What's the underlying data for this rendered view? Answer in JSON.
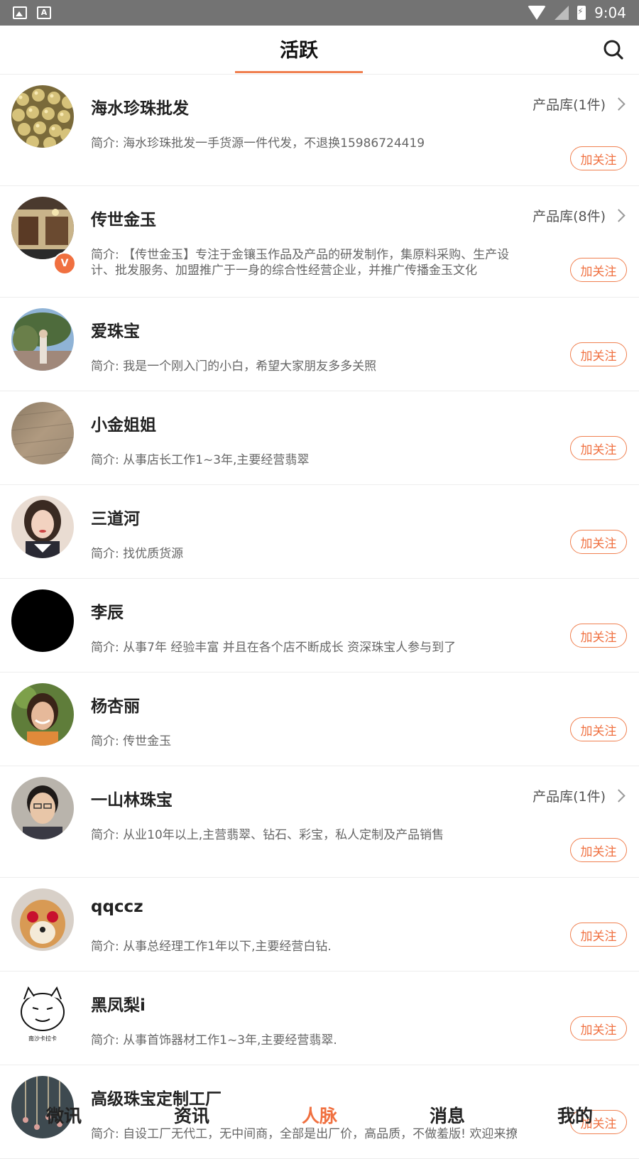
{
  "status_bar": {
    "time": "9:04",
    "font_icon_letter": "A"
  },
  "header": {
    "active_tab": "活跃"
  },
  "colors": {
    "accent": "#f07040",
    "status_bar": "#737373"
  },
  "list": [
    {
      "name": "海水珍珠批发",
      "bio": "简介: 海水珍珠批发一手货源一件代发，不退换15986724419",
      "products": "产品库(1件)",
      "follow": "加关注",
      "avatar": "pearl"
    },
    {
      "name": "传世金玉",
      "bio": "简介: 【传世金玉】专注于金镶玉作品及产品的研发制作，集原料采购、生产设计、批发服务、加盟推广于一身的综合性经营企业，并推广传播金玉文化",
      "products": "产品库(8件)",
      "follow": "加关注",
      "avatar": "store",
      "verified": "V"
    },
    {
      "name": "爱珠宝",
      "bio": "简介: 我是一个刚入门的小白，希望大家朋友多多关照",
      "follow": "加关注",
      "avatar": "tree"
    },
    {
      "name": "小金姐姐",
      "bio": "简介: 从事店长工作1~3年,主要经营翡翠",
      "follow": "加关注",
      "avatar": "wood"
    },
    {
      "name": "三道河",
      "bio": "简介: 找优质货源",
      "follow": "加关注",
      "avatar": "woman"
    },
    {
      "name": "李辰",
      "bio": "简介: 从事7年 经验丰富 并且在各个店不断成长 资深珠宝人参与到了",
      "follow": "加关注",
      "avatar": "black"
    },
    {
      "name": "杨杏丽",
      "bio": "简介: 传世金玉",
      "follow": "加关注",
      "avatar": "smile"
    },
    {
      "name": "一山林珠宝",
      "bio": "简介: 从业10年以上,主营翡翠、钻石、彩宝，私人定制及产品销售",
      "products": "产品库(1件)",
      "follow": "加关注",
      "avatar": "man"
    },
    {
      "name": "qqccz",
      "bio": "简介: 从事总经理工作1年以下,主要经营白钻.",
      "follow": "加关注",
      "avatar": "dog"
    },
    {
      "name": "黑凤梨i",
      "bio": "简介: 从事首饰器材工作1~3年,主要经营翡翠.",
      "follow": "加关注",
      "avatar": "cat",
      "avatar_caption": "南沙卡拉卡"
    },
    {
      "name": "高级珠宝定制工厂",
      "bio": "简介: 自设工厂无代工，无中间商，全部是出厂价，高品质，不做羞版! 欢迎来撩",
      "follow": "加关注",
      "avatar": "chains"
    }
  ],
  "bottom_nav": [
    {
      "label": "微讯",
      "active": false
    },
    {
      "label": "资讯",
      "active": false
    },
    {
      "label": "人脉",
      "active": true
    },
    {
      "label": "消息",
      "active": false
    },
    {
      "label": "我的",
      "active": false
    }
  ]
}
